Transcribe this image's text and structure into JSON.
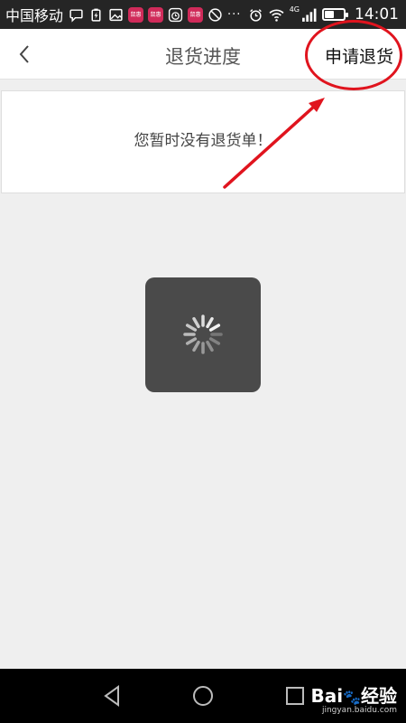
{
  "status_bar": {
    "carrier": "中国移动",
    "network": "4G",
    "time": "14:01",
    "battery_level": 0.45,
    "notifications": [
      "chat-bubble-icon",
      "battery-saver-icon",
      "gallery-icon",
      "app-badge-icon",
      "app-badge-icon",
      "alarm-app-icon",
      "app-badge-icon",
      "no-disturb-icon"
    ],
    "more": "···",
    "app_badge_text": "鼠惠"
  },
  "header": {
    "back_icon": "chevron-left-icon",
    "title": "退货进度",
    "action_label": "申请退货"
  },
  "empty_state": {
    "message": "您暂时没有退货单！"
  },
  "loading": {
    "icon": "spinner-icon"
  },
  "nav_bar": {
    "buttons": [
      "back-triangle-icon",
      "home-circle-icon",
      "recents-square-icon"
    ]
  },
  "watermark": {
    "brand": "Bai",
    "brand_suffix": "经验",
    "url": "jingyan.baidu.com"
  },
  "colors": {
    "annotation_red": "#e0141e",
    "status_bar_bg": "#252525",
    "page_bg": "#efefef",
    "loading_bg": "#4a4a4a"
  }
}
